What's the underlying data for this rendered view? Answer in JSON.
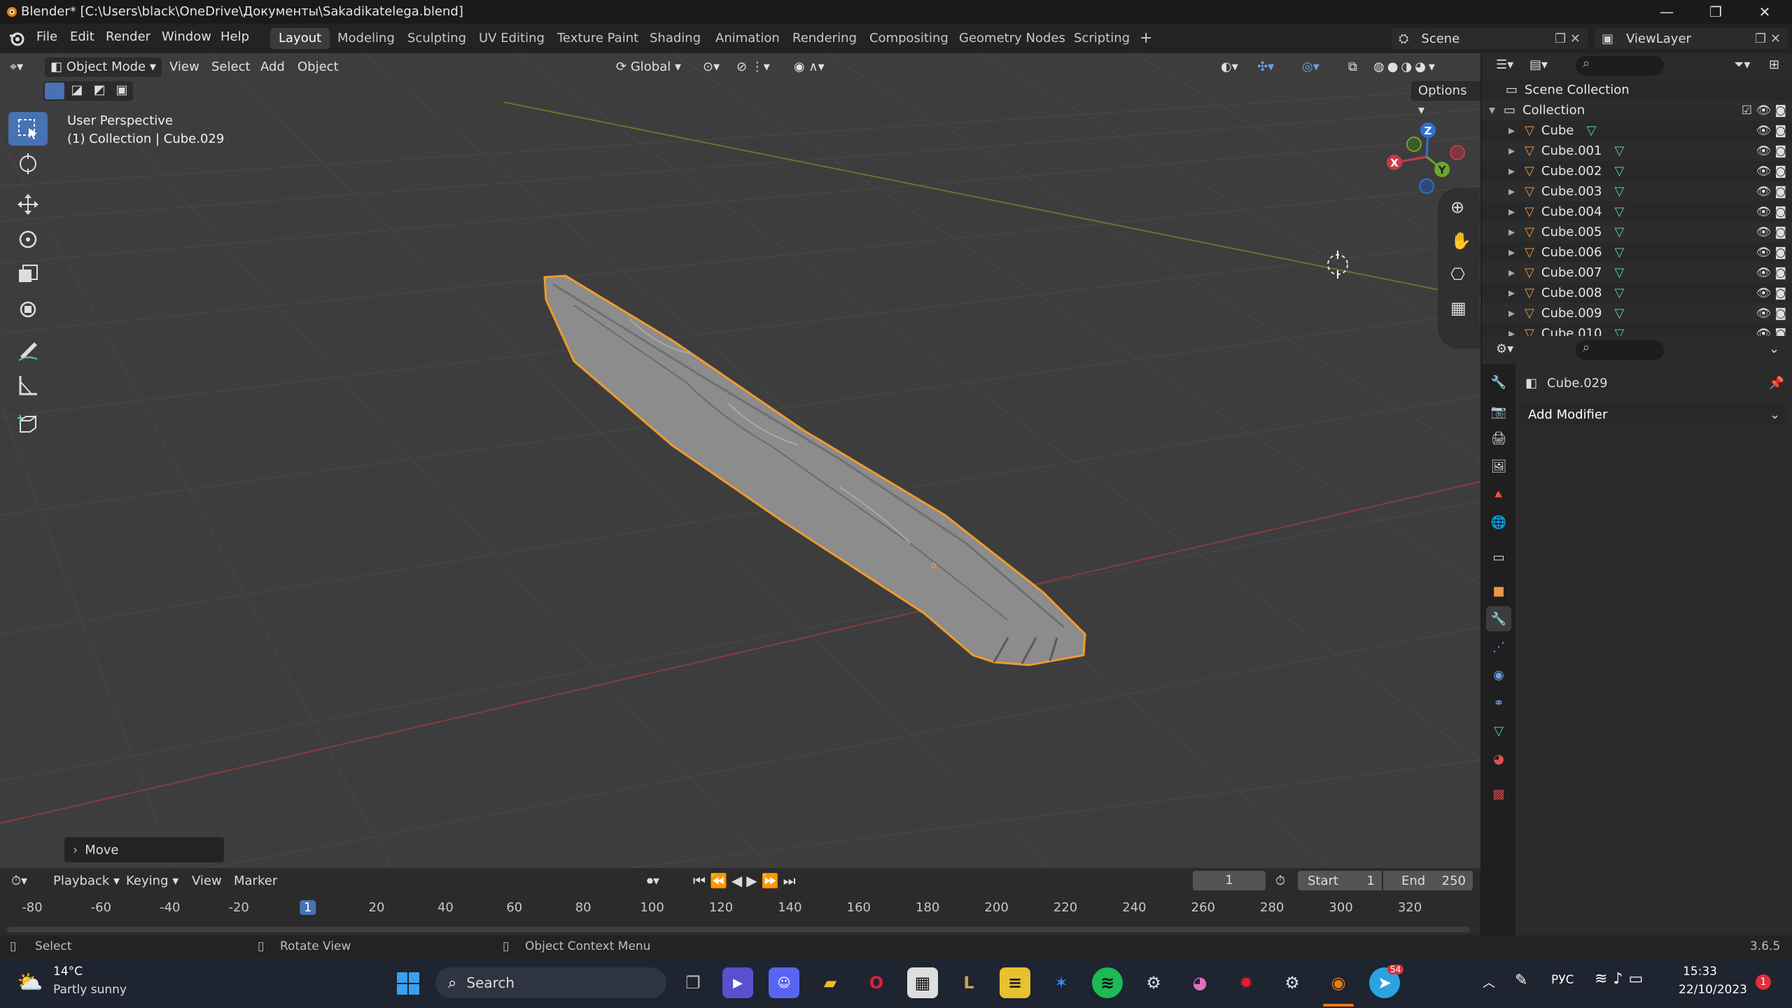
{
  "window": {
    "title": "Blender* [C:\\Users\\black\\OneDrive\\Документы\\Sakadikatelega.blend]",
    "minimize": "—",
    "restore": "❐",
    "close": "✕"
  },
  "menu": {
    "items": [
      "File",
      "Edit",
      "Render",
      "Window",
      "Help"
    ],
    "workspaces": [
      "Layout",
      "Modeling",
      "Sculpting",
      "UV Editing",
      "Texture Paint",
      "Shading",
      "Animation",
      "Rendering",
      "Compositing",
      "Geometry Nodes",
      "Scripting"
    ],
    "active_workspace": "Layout",
    "add_tab": "+",
    "scene": "Scene",
    "view_layer": "ViewLayer"
  },
  "viewport": {
    "mode": "Object Mode",
    "menus": [
      "View",
      "Select",
      "Add",
      "Object"
    ],
    "transform_orientation": "Global",
    "options": "Options",
    "perspective_label": "User Perspective",
    "collection_label": "(1) Collection | Cube.029",
    "last_operator": "Move",
    "gizmo": {
      "x": "X",
      "y": "Y",
      "z": "Z"
    }
  },
  "outliner": {
    "root": "Scene Collection",
    "collection": "Collection",
    "objects": [
      "Cube",
      "Cube.001",
      "Cube.002",
      "Cube.003",
      "Cube.004",
      "Cube.005",
      "Cube.006",
      "Cube.007",
      "Cube.008",
      "Cube.009",
      "Cube.010"
    ]
  },
  "properties": {
    "object_name": "Cube.029",
    "add_modifier": "Add Modifier"
  },
  "timeline": {
    "menus": [
      "Playback",
      "Keying",
      "View",
      "Marker"
    ],
    "current_frame": "1",
    "start_label": "Start",
    "start": "1",
    "end_label": "End",
    "end": "250",
    "ticks": [
      "-80",
      "-60",
      "-40",
      "-20",
      "1",
      "20",
      "40",
      "60",
      "80",
      "100",
      "120",
      "140",
      "160",
      "180",
      "200",
      "220",
      "240",
      "260",
      "280",
      "300",
      "320"
    ]
  },
  "statusbar": {
    "select": "Select",
    "rotate": "Rotate View",
    "context": "Object Context Menu",
    "version": "3.6.5"
  },
  "taskbar": {
    "temperature": "14°C",
    "weather": "Partly sunny",
    "search": "Search",
    "language": "РУС",
    "time": "15:33",
    "date": "22/10/2023",
    "notifications": "1",
    "telegram_badge": "54"
  },
  "colors": {
    "accent": "#4772b3",
    "selection_outline": "#f09a2e",
    "x_axis": "#b33b3b",
    "y_axis": "#6a8f2e"
  }
}
